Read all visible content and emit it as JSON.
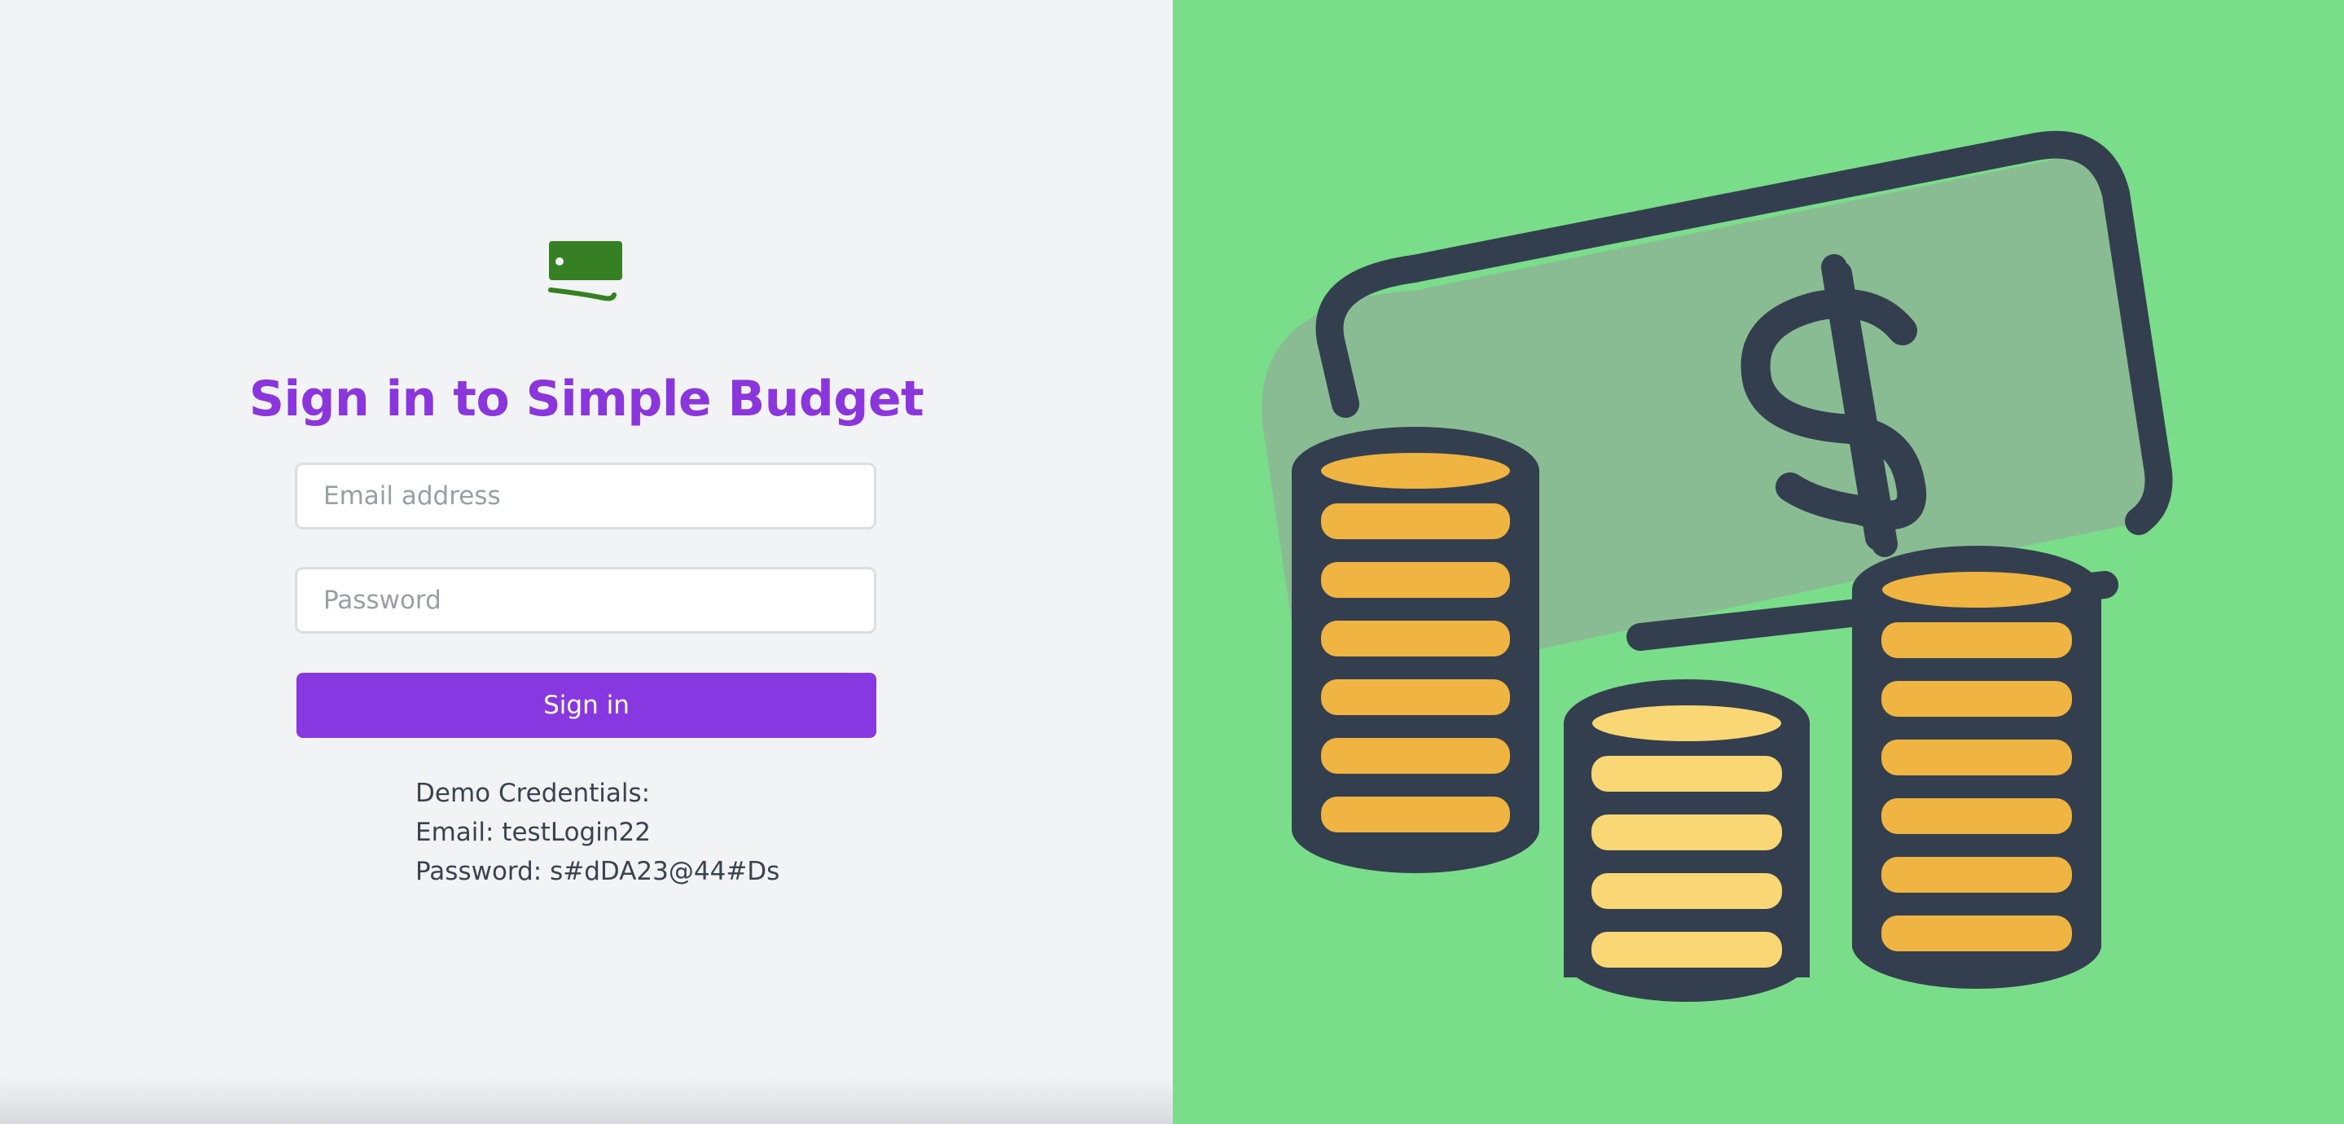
{
  "app": {
    "title": "Sign in to Simple Budget"
  },
  "logo": {
    "icon": "money-bill-icon",
    "color": "#368023"
  },
  "form": {
    "email_placeholder": "Email address",
    "email_value": "",
    "password_placeholder": "Password",
    "password_value": "",
    "signin_label": "Sign in"
  },
  "demo": {
    "heading": "Demo Credentials:",
    "email_line": "Email: testLogin22",
    "password_line": "Password: s#dDA23@44#Ds"
  },
  "illustration": {
    "icon": "money-and-coins-icon",
    "background": "#7add8a",
    "bill_color": "#8abc94",
    "outline_color": "#333f4e",
    "coin_dark": "#efb442",
    "coin_light": "#f9d775"
  },
  "colors": {
    "accent": "#8838e0",
    "title": "#8a36dc",
    "left_background": "#f2f3f5"
  }
}
